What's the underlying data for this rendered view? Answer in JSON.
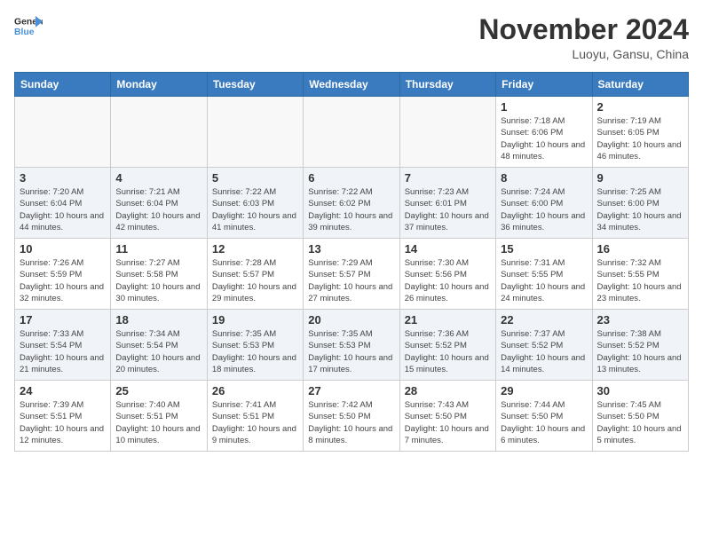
{
  "header": {
    "logo_line1": "General",
    "logo_line2": "Blue",
    "month": "November 2024",
    "location": "Luoyu, Gansu, China"
  },
  "weekdays": [
    "Sunday",
    "Monday",
    "Tuesday",
    "Wednesday",
    "Thursday",
    "Friday",
    "Saturday"
  ],
  "weeks": [
    [
      {
        "day": "",
        "info": ""
      },
      {
        "day": "",
        "info": ""
      },
      {
        "day": "",
        "info": ""
      },
      {
        "day": "",
        "info": ""
      },
      {
        "day": "",
        "info": ""
      },
      {
        "day": "1",
        "info": "Sunrise: 7:18 AM\nSunset: 6:06 PM\nDaylight: 10 hours\nand 48 minutes."
      },
      {
        "day": "2",
        "info": "Sunrise: 7:19 AM\nSunset: 6:05 PM\nDaylight: 10 hours\nand 46 minutes."
      }
    ],
    [
      {
        "day": "3",
        "info": "Sunrise: 7:20 AM\nSunset: 6:04 PM\nDaylight: 10 hours\nand 44 minutes."
      },
      {
        "day": "4",
        "info": "Sunrise: 7:21 AM\nSunset: 6:04 PM\nDaylight: 10 hours\nand 42 minutes."
      },
      {
        "day": "5",
        "info": "Sunrise: 7:22 AM\nSunset: 6:03 PM\nDaylight: 10 hours\nand 41 minutes."
      },
      {
        "day": "6",
        "info": "Sunrise: 7:22 AM\nSunset: 6:02 PM\nDaylight: 10 hours\nand 39 minutes."
      },
      {
        "day": "7",
        "info": "Sunrise: 7:23 AM\nSunset: 6:01 PM\nDaylight: 10 hours\nand 37 minutes."
      },
      {
        "day": "8",
        "info": "Sunrise: 7:24 AM\nSunset: 6:00 PM\nDaylight: 10 hours\nand 36 minutes."
      },
      {
        "day": "9",
        "info": "Sunrise: 7:25 AM\nSunset: 6:00 PM\nDaylight: 10 hours\nand 34 minutes."
      }
    ],
    [
      {
        "day": "10",
        "info": "Sunrise: 7:26 AM\nSunset: 5:59 PM\nDaylight: 10 hours\nand 32 minutes."
      },
      {
        "day": "11",
        "info": "Sunrise: 7:27 AM\nSunset: 5:58 PM\nDaylight: 10 hours\nand 30 minutes."
      },
      {
        "day": "12",
        "info": "Sunrise: 7:28 AM\nSunset: 5:57 PM\nDaylight: 10 hours\nand 29 minutes."
      },
      {
        "day": "13",
        "info": "Sunrise: 7:29 AM\nSunset: 5:57 PM\nDaylight: 10 hours\nand 27 minutes."
      },
      {
        "day": "14",
        "info": "Sunrise: 7:30 AM\nSunset: 5:56 PM\nDaylight: 10 hours\nand 26 minutes."
      },
      {
        "day": "15",
        "info": "Sunrise: 7:31 AM\nSunset: 5:55 PM\nDaylight: 10 hours\nand 24 minutes."
      },
      {
        "day": "16",
        "info": "Sunrise: 7:32 AM\nSunset: 5:55 PM\nDaylight: 10 hours\nand 23 minutes."
      }
    ],
    [
      {
        "day": "17",
        "info": "Sunrise: 7:33 AM\nSunset: 5:54 PM\nDaylight: 10 hours\nand 21 minutes."
      },
      {
        "day": "18",
        "info": "Sunrise: 7:34 AM\nSunset: 5:54 PM\nDaylight: 10 hours\nand 20 minutes."
      },
      {
        "day": "19",
        "info": "Sunrise: 7:35 AM\nSunset: 5:53 PM\nDaylight: 10 hours\nand 18 minutes."
      },
      {
        "day": "20",
        "info": "Sunrise: 7:35 AM\nSunset: 5:53 PM\nDaylight: 10 hours\nand 17 minutes."
      },
      {
        "day": "21",
        "info": "Sunrise: 7:36 AM\nSunset: 5:52 PM\nDaylight: 10 hours\nand 15 minutes."
      },
      {
        "day": "22",
        "info": "Sunrise: 7:37 AM\nSunset: 5:52 PM\nDaylight: 10 hours\nand 14 minutes."
      },
      {
        "day": "23",
        "info": "Sunrise: 7:38 AM\nSunset: 5:52 PM\nDaylight: 10 hours\nand 13 minutes."
      }
    ],
    [
      {
        "day": "24",
        "info": "Sunrise: 7:39 AM\nSunset: 5:51 PM\nDaylight: 10 hours\nand 12 minutes."
      },
      {
        "day": "25",
        "info": "Sunrise: 7:40 AM\nSunset: 5:51 PM\nDaylight: 10 hours\nand 10 minutes."
      },
      {
        "day": "26",
        "info": "Sunrise: 7:41 AM\nSunset: 5:51 PM\nDaylight: 10 hours\nand 9 minutes."
      },
      {
        "day": "27",
        "info": "Sunrise: 7:42 AM\nSunset: 5:50 PM\nDaylight: 10 hours\nand 8 minutes."
      },
      {
        "day": "28",
        "info": "Sunrise: 7:43 AM\nSunset: 5:50 PM\nDaylight: 10 hours\nand 7 minutes."
      },
      {
        "day": "29",
        "info": "Sunrise: 7:44 AM\nSunset: 5:50 PM\nDaylight: 10 hours\nand 6 minutes."
      },
      {
        "day": "30",
        "info": "Sunrise: 7:45 AM\nSunset: 5:50 PM\nDaylight: 10 hours\nand 5 minutes."
      }
    ]
  ]
}
